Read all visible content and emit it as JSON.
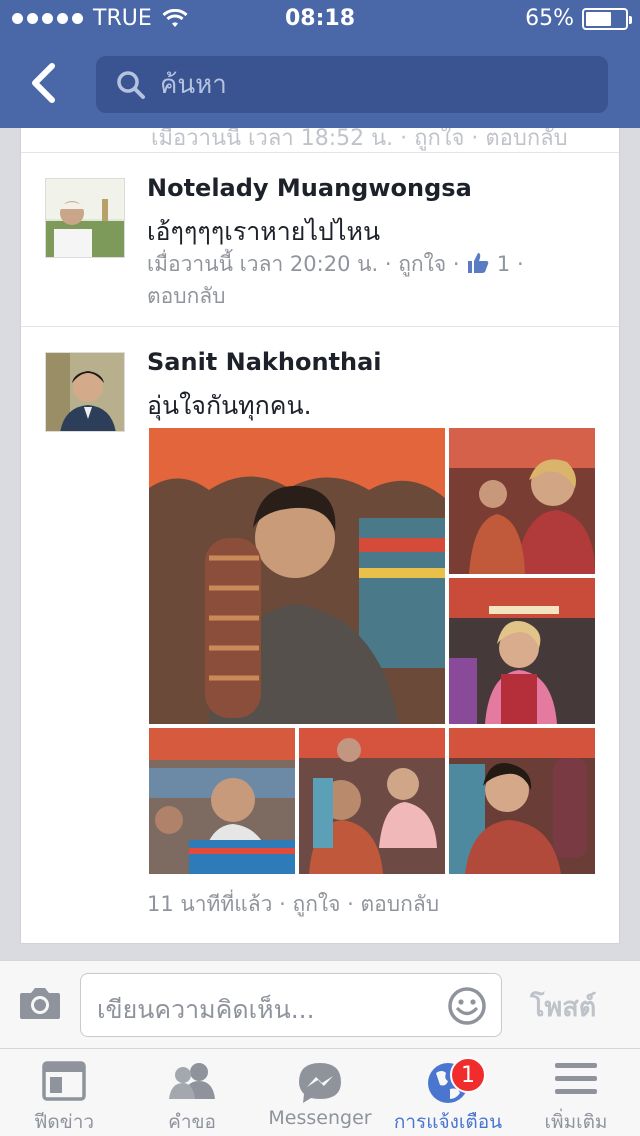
{
  "status_bar": {
    "carrier": "TRUE",
    "time": "08:18",
    "battery": "65%",
    "battery_level": 0.65
  },
  "nav": {
    "back_icon": "chevron-left-icon",
    "search_placeholder": "ค้นหา"
  },
  "feed": {
    "previous_meta_fragment": "เมื่อวานนี้ เวลา 18:52 น. · ถูกใจ · ตอบกลับ",
    "comments": [
      {
        "author": "Notelady Muangwongsa",
        "text": "เอ้ๆๆๆๆเราหายไปไหน",
        "timestamp": "เมื่อวานนี้ เวลา 20:20 น.",
        "like_label": "ถูกใจ",
        "like_count": "1",
        "reply_label": "ตอบกลับ"
      },
      {
        "author": "Sanit Nakhonthai",
        "text": "อุ่นใจกันทุกคน.",
        "timestamp": "11 นาทีที่แล้ว",
        "like_label": "ถูกใจ",
        "reply_label": "ตอบกลับ",
        "photo_count": 6
      }
    ]
  },
  "composer": {
    "placeholder": "เขียนความคิดเห็น...",
    "post_label": "โพสต์",
    "camera_icon": "camera-icon",
    "emoji_icon": "emoji-icon"
  },
  "tabbar": {
    "tabs": [
      {
        "label": "ฟีดข่าว",
        "icon": "news-feed-icon"
      },
      {
        "label": "คำขอ",
        "icon": "friend-requests-icon"
      },
      {
        "label": "Messenger",
        "icon": "messenger-icon"
      },
      {
        "label": "การแจ้งเตือน",
        "icon": "globe-icon",
        "badge": "1",
        "active": true
      },
      {
        "label": "เพิ่มเติม",
        "icon": "menu-icon"
      }
    ]
  },
  "colors": {
    "header_bg": "#4a67a8",
    "search_bg": "#3a5491",
    "accent": "#4a76d0",
    "badge": "#f12c2c",
    "meta_text": "#90949c"
  }
}
